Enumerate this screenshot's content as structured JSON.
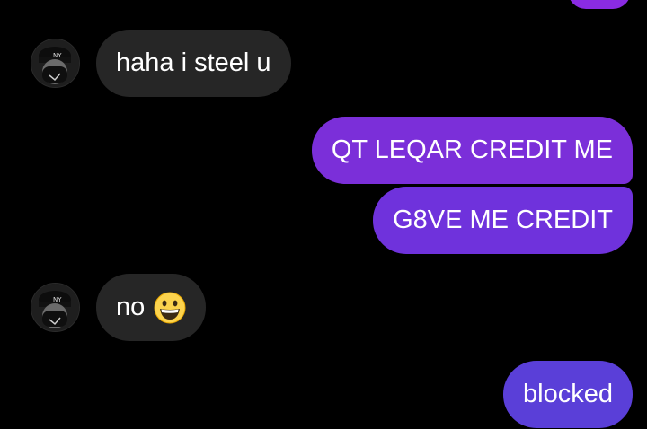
{
  "messages": [
    {
      "direction": "incoming",
      "text": "haha i steel u"
    },
    {
      "direction": "outgoing",
      "text": "QT LEQAR CREDIT ME"
    },
    {
      "direction": "outgoing",
      "text": "G8VE ME CREDIT"
    },
    {
      "direction": "incoming",
      "text": "no",
      "emoji": "grinning-face-icon"
    },
    {
      "direction": "outgoing",
      "text": "blocked"
    }
  ],
  "colors": {
    "background": "#000000",
    "incoming_bubble": "#262626",
    "outgoing_top": "#8a2be2",
    "outgoing_bottom": "#5a3fd8"
  }
}
